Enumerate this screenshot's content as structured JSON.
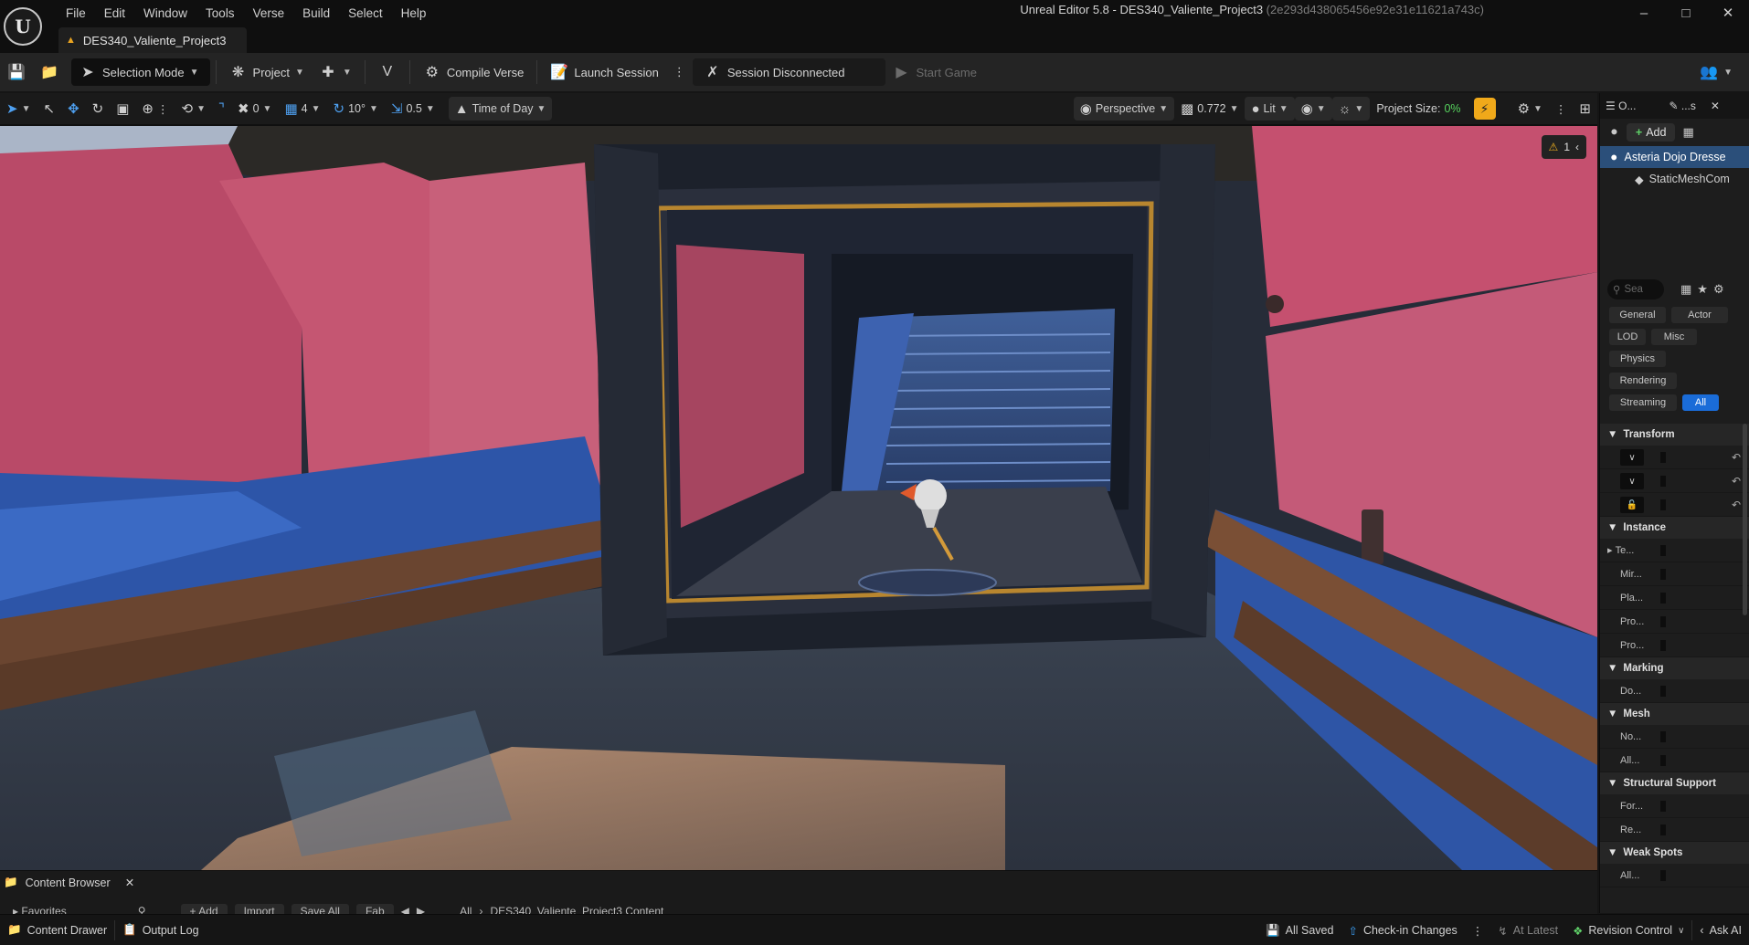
{
  "window": {
    "title": "Unreal Editor 5.8 - DES340_Valiente_Project3",
    "hash": "(2e293d438065456e92e31e11621a743c)",
    "controls": [
      "minimize-icon",
      "maximize-icon",
      "close-icon"
    ]
  },
  "menu": [
    "File",
    "Edit",
    "Window",
    "Tools",
    "Verse",
    "Build",
    "Select",
    "Help"
  ],
  "doc_tab": {
    "label": "DES340_Valiente_Project3"
  },
  "toolbar": {
    "selection_mode": "Selection Mode",
    "project": "Project",
    "compile_verse": "Compile Verse",
    "launch_session": "Launch Session",
    "session_status": "Session Disconnected",
    "start_game": "Start Game"
  },
  "viewport_toolbar": {
    "rotate_snap": "0",
    "grid_snap": "4",
    "angle_snap": "10°",
    "scale_snap": "0.5",
    "time_of_day": "Time of Day",
    "perspective": "Perspective",
    "camera_speed": "0.772",
    "view_mode": "Lit",
    "project_size_label": "Project Size:",
    "project_size_value": "0%"
  },
  "viewport": {
    "warning_count": "1"
  },
  "outliner": {
    "tab_outliner": "O...",
    "tab_details": "...s",
    "add_label": "Add",
    "selected_actor": "Asteria Dojo Dresse",
    "component": "StaticMeshCom",
    "search_placeholder": "Sea"
  },
  "details": {
    "filters": [
      "General",
      "Actor",
      "LOD",
      "Misc",
      "Physics",
      "Rendering",
      "Streaming",
      "All"
    ],
    "active_filter": "All",
    "sections": [
      {
        "name": "Transform",
        "rows": [
          "",
          "",
          ""
        ]
      },
      {
        "name": "Instance",
        "rows": [
          "Te...",
          "Mir...",
          "Pla...",
          "Pro...",
          "Pro..."
        ]
      },
      {
        "name": "Marking",
        "rows": [
          "Do..."
        ]
      },
      {
        "name": "Mesh",
        "rows": [
          "No...",
          "All..."
        ]
      },
      {
        "name": "Structural Support",
        "rows": [
          "For...",
          "Re..."
        ]
      },
      {
        "name": "Weak Spots",
        "rows": [
          "All..."
        ]
      }
    ]
  },
  "content_browser": {
    "tab_label": "Content Browser",
    "favorites": "Favorites",
    "add": "Add",
    "import": "Import",
    "save_all": "Save All",
    "fab": "Fab",
    "path_all": "All",
    "path_project": "DES340_Valiente_Project3 Content"
  },
  "statusbar": {
    "content_drawer": "Content Drawer",
    "output_log": "Output Log",
    "all_saved": "All Saved",
    "check_in": "Check-in Changes",
    "at_latest": "At Latest",
    "revision_control": "Revision Control",
    "ask_ai": "Ask AI"
  },
  "colors": {
    "accent_blue": "#1a6cd8",
    "selection_blue": "#2b4f7a",
    "success_green": "#56d35e",
    "realtime_orange": "#f0a91a",
    "warning_yellow": "#f0b020"
  }
}
